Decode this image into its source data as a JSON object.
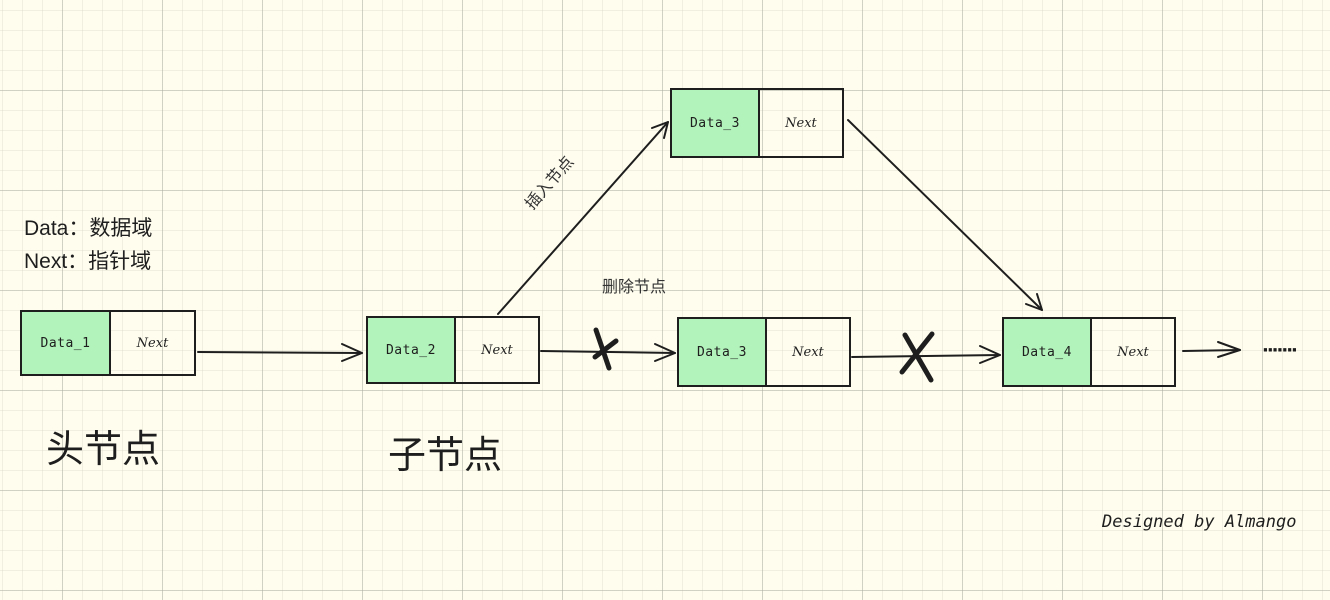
{
  "legend": {
    "data_line": "Data：数据域",
    "next_line": "Next：指针域"
  },
  "nodes": [
    {
      "data": "Data_1",
      "next": "Next"
    },
    {
      "data": "Data_2",
      "next": "Next"
    },
    {
      "data": "Data_3",
      "next": "Next"
    },
    {
      "data": "Data_3",
      "next": "Next"
    },
    {
      "data": "Data_4",
      "next": "Next"
    }
  ],
  "labels": {
    "head_node": "头节点",
    "child_node": "子节点",
    "insert_node": "插入节点",
    "delete_node": "删除节点",
    "ellipsis": "·······",
    "signature": "Designed by Almango"
  },
  "colors": {
    "data_fill": "#b2f2bb",
    "stroke": "#1e1e1e",
    "background": "#fffdee"
  }
}
